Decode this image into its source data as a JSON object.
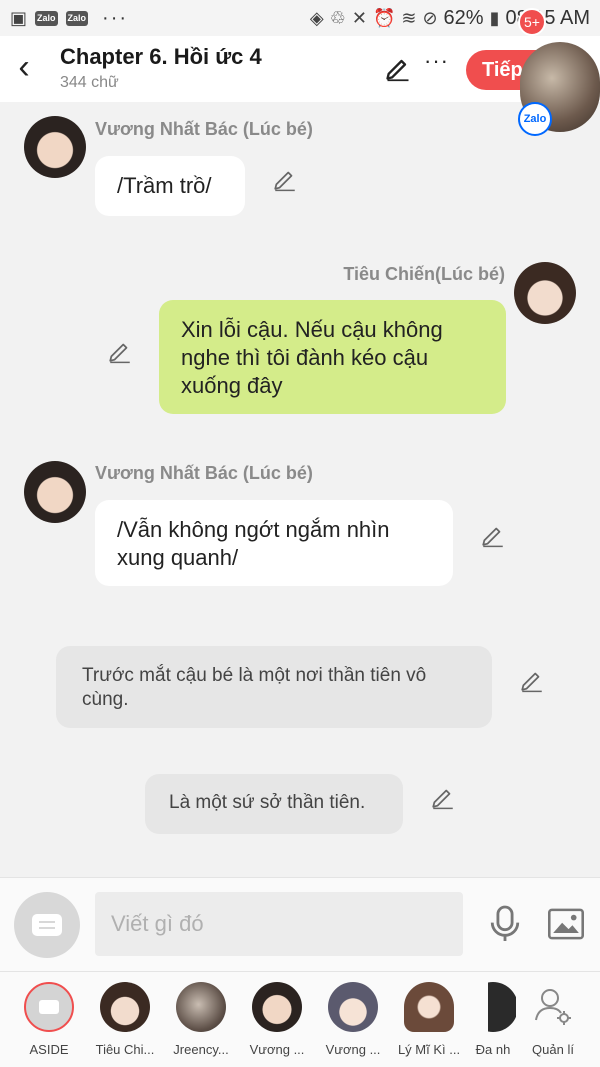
{
  "status_bar": {
    "left_apps": [
      "Zalo",
      "Zalo"
    ],
    "more": "···",
    "battery": "62%",
    "time": "08:15 AM"
  },
  "header": {
    "title": "Chapter 6. Hồi ức 4",
    "subtitle": "344 chữ",
    "next_label": "Tiếp",
    "badge": "5+",
    "zalo_label": "Zalo",
    "more_label": "···"
  },
  "messages": [
    {
      "speaker": "Vương Nhất Bác (Lúc bé)",
      "text": "/Trầm trồ/"
    },
    {
      "speaker": "Tiêu Chiến(Lúc bé)",
      "text": "Xin lỗi cậu. Nếu cậu không nghe thì tôi đành kéo cậu xuống đây"
    },
    {
      "speaker": "Vương Nhất Bác (Lúc bé)",
      "text": "/Vẫn không ngớt ngắm nhìn xung quanh/"
    },
    {
      "speaker": "",
      "text": "Trước mắt cậu bé là một nơi thần tiên vô cùng."
    },
    {
      "speaker": "",
      "text": "Là một sứ sở thần tiên."
    }
  ],
  "input": {
    "placeholder": "Viết gì đó"
  },
  "characters": [
    {
      "label": "ASIDE"
    },
    {
      "label": "Tiêu Chi..."
    },
    {
      "label": "Jreency..."
    },
    {
      "label": "Vương ..."
    },
    {
      "label": "Vương ..."
    },
    {
      "label": "Lý Mĩ Kì ..."
    },
    {
      "label": "Đa nh"
    },
    {
      "label": "Quản lí"
    }
  ],
  "colors": {
    "accent": "#f04e4e",
    "green_bubble": "#d4ec8a",
    "aside_bubble": "#e6e6e6",
    "background": "#f2f2f2"
  }
}
